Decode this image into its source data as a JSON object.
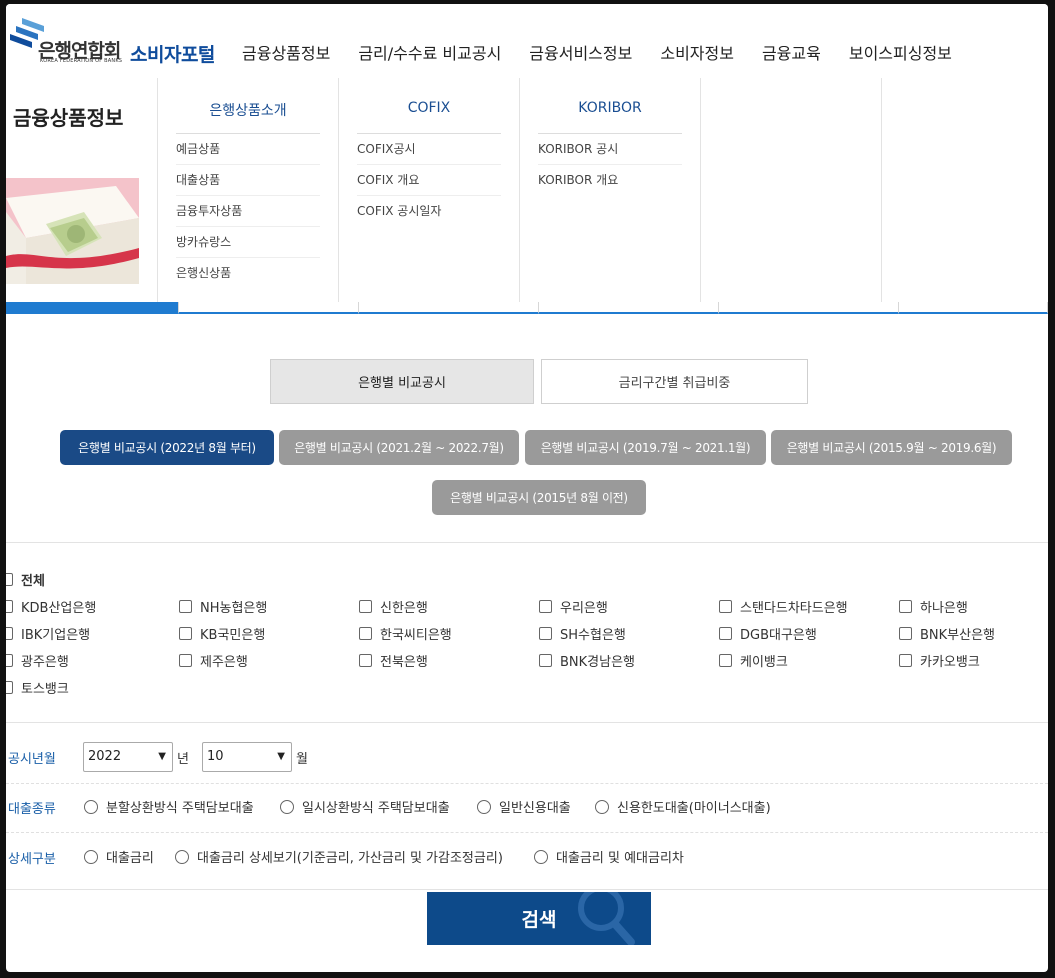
{
  "header": {
    "logo_kr": "은행연합회",
    "logo_en": "KOREA FEDERATION OF BANKS",
    "portal": "소비자포털",
    "nav": [
      "금융상품정보",
      "금리/수수료 비교공시",
      "금융서비스정보",
      "소비자정보",
      "금융교육",
      "보이스피싱정보"
    ]
  },
  "dropdown": {
    "title": "금융상품정보",
    "columns": [
      {
        "head": "은행상품소개",
        "items": [
          "예금상품",
          "대출상품",
          "금융투자상품",
          "방카슈랑스",
          "은행신상품"
        ]
      },
      {
        "head": "COFIX",
        "items": [
          "COFIX공시",
          "COFIX 개요",
          "COFIX 공시일자"
        ]
      },
      {
        "head": "KORIBOR",
        "items": [
          "KORIBOR 공시",
          "KORIBOR 개요"
        ]
      }
    ]
  },
  "toggles": {
    "on": "은행별 비교공시",
    "off": "금리구간별 취급비중"
  },
  "periods": [
    "은행별 비교공시 (2022년 8월 부터)",
    "은행별 비교공시 (2021.2월 ~ 2022.7월)",
    "은행별 비교공시 (2019.7월 ~ 2021.1월)",
    "은행별 비교공시 (2015.9월 ~ 2019.6월)",
    "은행별 비교공시 (2015년 8월 이전)"
  ],
  "banks": {
    "all": "전체",
    "list": [
      "KDB산업은행",
      "NH농협은행",
      "신한은행",
      "우리은행",
      "스탠다드차타드은행",
      "하나은행",
      "IBK기업은행",
      "KB국민은행",
      "한국씨티은행",
      "SH수협은행",
      "DGB대구은행",
      "BNK부산은행",
      "광주은행",
      "제주은행",
      "전북은행",
      "BNK경남은행",
      "케이뱅크",
      "카카오뱅크",
      "토스뱅크"
    ]
  },
  "form": {
    "period_label": "공시년월",
    "year": "2022",
    "year_unit": "년",
    "month": "10",
    "month_unit": "월",
    "loan_type_label": "대출종류",
    "loan_types": [
      "분할상환방식 주택담보대출",
      "일시상환방식 주택담보대출",
      "일반신용대출",
      "신용한도대출(마이너스대출)"
    ],
    "detail_label": "상세구분",
    "details": [
      "대출금리",
      "대출금리 상세보기(기준금리, 가산금리 및 가감조정금리)",
      "대출금리 및 예대금리차"
    ],
    "search": "검색"
  },
  "colors": {
    "brand": "#0f4c9c",
    "active_pill": "#1a4a86",
    "inactive_pill": "#9a9a9a",
    "search_button": "#0d4a8a",
    "label": "#1a5fa8"
  }
}
